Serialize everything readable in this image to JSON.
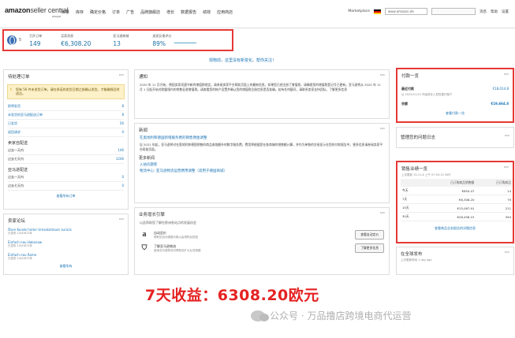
{
  "header": {
    "logo_main": "amazon",
    "logo_sub": "seller central",
    "logo_region": "europe",
    "nav": [
      "目录",
      "库存",
      "确定价格",
      "订单",
      "广告",
      "品牌旗舰店",
      "增长",
      "数据报告",
      "绩效",
      "应用商店"
    ],
    "marketplace_label": "Marketplace",
    "marketplace_value": "www.amazon.de",
    "search_placeholder": "",
    "right_links": [
      "消息",
      "帮助",
      "设置"
    ]
  },
  "metrics": {
    "count_label": "5",
    "items": [
      {
        "label": "打开订单",
        "value": "149"
      },
      {
        "label": "买家消息",
        "value": "€6,308.20"
      },
      {
        "label": "亚马逊商城",
        "value": "13"
      },
      {
        "label": "卖家反馈评分",
        "value": "89%"
      }
    ]
  },
  "banner": "观物前，这里没有新变化。帮你关注！",
  "orders_card": {
    "title": "待处理订单",
    "warning": "您有 56 件未发货订单。请在承诺的发货日期之前确认发货，才能确保及时送达。",
    "rows": [
      {
        "label": "即将发货",
        "value": "8"
      },
      {
        "label": "未发货的亚马逊配送订单",
        "value": "8"
      },
      {
        "label": "已发货",
        "value": "56"
      },
      {
        "label": "退回请求",
        "value": "0"
      }
    ],
    "section1": "卖家自配送",
    "rows2": [
      {
        "label": "过去一天内",
        "value": "146"
      },
      {
        "label": "过去七天内",
        "value": "1246"
      }
    ],
    "section2": "亚马逊配送",
    "rows3": [
      {
        "label": "过去一天内",
        "value": "0"
      },
      {
        "label": "过去七天内",
        "value": "0"
      }
    ],
    "link": "查看所有订单"
  },
  "forum_card": {
    "title": "卖家论坛",
    "items": [
      {
        "title": "Ösen Kunde hinter Umsatzsteuer zurück",
        "date": "已发布 1/5/0672年"
      },
      {
        "title": "Einfach neu Hakenaw",
        "date": "已发布 1/5/0672年"
      },
      {
        "title": "Einfach neu Rome",
        "date": "已发布 1/5/0672年"
      }
    ],
    "link": "查看所有"
  },
  "notice_card": {
    "title": "通知",
    "text": "2020 年 11 月开始，德国卖家须遵守新的增值税规定。请参阅卖家平台帮助页面上的最新信息。如果您已经注册了增值税，请确保您的增值税登记号已更新。亚马逊将从 2020 年 11 月 1 日起开始对欧盟境内的销售征收增值税。请查看您的帐户设置并确认您的增值税注册信息是否准确。若有任何疑问，请联系卖家支持团队。了解更多信息"
  },
  "news_card": {
    "title": "新闻",
    "headline": "在奥地利和德国新增服务费的销售佣金调整",
    "text": "自 2021 年起，亚马逊将对在奥地利和德国销售的商品收取额外的数字服务费。费用将根据您在各商城的销售额计算，并作为单独的交易显示在您的付款报告中。更多信息请参阅卖家平台帮助页面。",
    "more_title": "更多新闻",
    "more_items": [
      "入站问题新",
      "物流中心: 亚马逊物流运营费用调整（适用于德国商城）"
    ]
  },
  "growth_card": {
    "title": "业务增长引擎",
    "subtitle": "以此帮助您了解在欧洲各站点的发展机会",
    "feeds": [
      {
        "title": "自动定价",
        "desc": "帮助您自动调整价格以赢得购买按钮",
        "button": "查看自动定价"
      },
      {
        "title": "了解亚马逊物流",
        "desc": "使用亚马逊物流可帮助您扩大业务规模",
        "button": "了解更多信息"
      }
    ]
  },
  "payment_card": {
    "title": "付款一览",
    "rows": [
      {
        "label": "最近付款",
        "value": "€18,014.8"
      },
      {
        "label": "余额",
        "value": "€19,664.8"
      }
    ],
    "note": "从 2023/11/15 开始将存入您的银行账户",
    "link": "查看付款一览"
  },
  "issues_card": {
    "title": "管理您的问题日志"
  },
  "sales_card": {
    "title": "销售业绩一览",
    "subtitle": "上次更新 15-11-6 上午 07:03:15 GMT",
    "headers": [
      "",
      "已订购商品销售额",
      "已订购商品"
    ],
    "rows": [
      [
        "今天",
        "€854.47",
        "14"
      ],
      [
        "7天",
        "€6,308.20",
        "79"
      ],
      [
        "15天",
        "€15,067.91",
        "211"
      ],
      [
        "30天",
        "€28,458.15",
        "394"
      ]
    ],
    "link": "查看商品业务报告的详细信息"
  },
  "global_card": {
    "title": "在全球发布",
    "note": "上次更新时间 1 day ago"
  },
  "caption": "7天收益：6308.20欧元",
  "watermark": "公众号 · 万品撸店跨境电商代运营"
}
